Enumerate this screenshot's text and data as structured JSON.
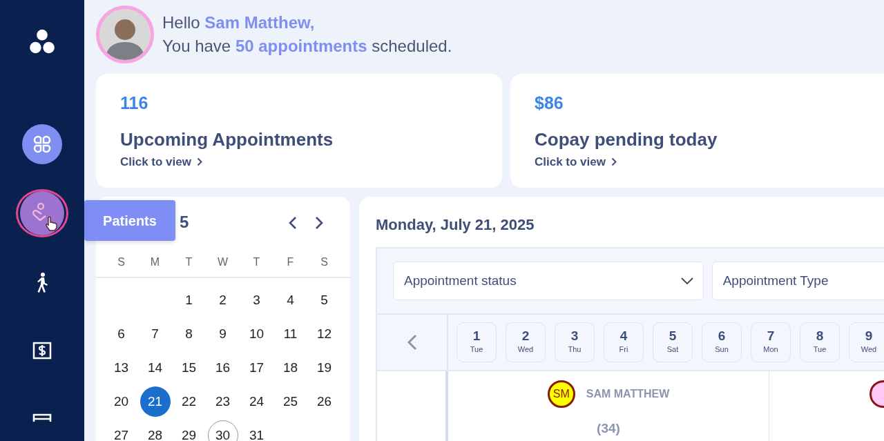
{
  "sidebar": {
    "items": [
      {
        "kind": "dashboard",
        "selected": true,
        "hovered": false
      },
      {
        "kind": "patients",
        "selected": false,
        "hovered": true,
        "tooltip": "Patients"
      },
      {
        "kind": "walk-in",
        "selected": false,
        "hovered": false
      },
      {
        "kind": "billing",
        "selected": false,
        "hovered": false
      },
      {
        "kind": "list",
        "selected": false,
        "hovered": false
      }
    ]
  },
  "header": {
    "greeting": "Hello **Sam Matthew,**",
    "summary": "You have **50 appointments** scheduled."
  },
  "stats": [
    {
      "value": "116",
      "label": "Upcoming Appointments",
      "link": "Click to view"
    },
    {
      "value": "$86",
      "label": "Copay pending today",
      "link": "Click to view"
    }
  ],
  "calendar": {
    "title": "5",
    "weekdays": [
      "S",
      "M",
      "T",
      "W",
      "T",
      "F",
      "S"
    ],
    "weeks": [
      [
        {
          "kind": "empty"
        },
        {
          "kind": "empty"
        },
        {
          "kind": "day",
          "day": "1",
          "selected": false,
          "today": false
        },
        {
          "kind": "day",
          "day": "2",
          "selected": false,
          "today": false
        },
        {
          "kind": "day",
          "day": "3",
          "selected": false,
          "today": false
        },
        {
          "kind": "day",
          "day": "4",
          "selected": false,
          "today": false
        },
        {
          "kind": "day",
          "day": "5",
          "selected": false,
          "today": false
        }
      ],
      [
        {
          "kind": "day",
          "day": "6",
          "selected": false,
          "today": false
        },
        {
          "kind": "day",
          "day": "7",
          "selected": false,
          "today": false
        },
        {
          "kind": "day",
          "day": "8",
          "selected": false,
          "today": false
        },
        {
          "kind": "day",
          "day": "9",
          "selected": false,
          "today": false
        },
        {
          "kind": "day",
          "day": "10",
          "selected": false,
          "today": false
        },
        {
          "kind": "day",
          "day": "11",
          "selected": false,
          "today": false
        },
        {
          "kind": "day",
          "day": "12",
          "selected": false,
          "today": false
        }
      ],
      [
        {
          "kind": "day",
          "day": "13",
          "selected": false,
          "today": false
        },
        {
          "kind": "day",
          "day": "14",
          "selected": false,
          "today": false
        },
        {
          "kind": "day",
          "day": "15",
          "selected": false,
          "today": false
        },
        {
          "kind": "day",
          "day": "16",
          "selected": false,
          "today": false
        },
        {
          "kind": "day",
          "day": "17",
          "selected": false,
          "today": false
        },
        {
          "kind": "day",
          "day": "18",
          "selected": false,
          "today": false
        },
        {
          "kind": "day",
          "day": "19",
          "selected": false,
          "today": false
        }
      ],
      [
        {
          "kind": "day",
          "day": "20",
          "selected": false,
          "today": false
        },
        {
          "kind": "day",
          "day": "21",
          "selected": true,
          "today": false
        },
        {
          "kind": "day",
          "day": "22",
          "selected": false,
          "today": false
        },
        {
          "kind": "day",
          "day": "23",
          "selected": false,
          "today": false
        },
        {
          "kind": "day",
          "day": "24",
          "selected": false,
          "today": false
        },
        {
          "kind": "day",
          "day": "25",
          "selected": false,
          "today": false
        },
        {
          "kind": "day",
          "day": "26",
          "selected": false,
          "today": false
        }
      ],
      [
        {
          "kind": "day",
          "day": "27",
          "selected": false,
          "today": false
        },
        {
          "kind": "day",
          "day": "28",
          "selected": false,
          "today": false
        },
        {
          "kind": "day",
          "day": "29",
          "selected": false,
          "today": false
        },
        {
          "kind": "day",
          "day": "30",
          "selected": false,
          "today": true
        },
        {
          "kind": "day",
          "day": "31",
          "selected": false,
          "today": false
        }
      ]
    ]
  },
  "schedule": {
    "date_title": "Monday, July 21, 2025",
    "filters": [
      {
        "label": "Appointment status",
        "kind": "dropdown"
      },
      {
        "label": "Appointment Type",
        "kind": "dropdown-cut"
      }
    ],
    "days": [
      {
        "day": "1",
        "weekday": "Tue"
      },
      {
        "day": "2",
        "weekday": "Wed"
      },
      {
        "day": "3",
        "weekday": "Thu"
      },
      {
        "day": "4",
        "weekday": "Fri"
      },
      {
        "day": "5",
        "weekday": "Sat"
      },
      {
        "day": "6",
        "weekday": "Sun"
      },
      {
        "day": "7",
        "weekday": "Mon"
      },
      {
        "day": "8",
        "weekday": "Tue"
      },
      {
        "day": "9",
        "weekday": "Wed"
      }
    ],
    "providers": [
      {
        "initials": "SM",
        "name": "SAM MATTHEW",
        "count": "(34)",
        "color": "#ffff00"
      },
      {
        "color": "#ffc8f5"
      }
    ]
  }
}
